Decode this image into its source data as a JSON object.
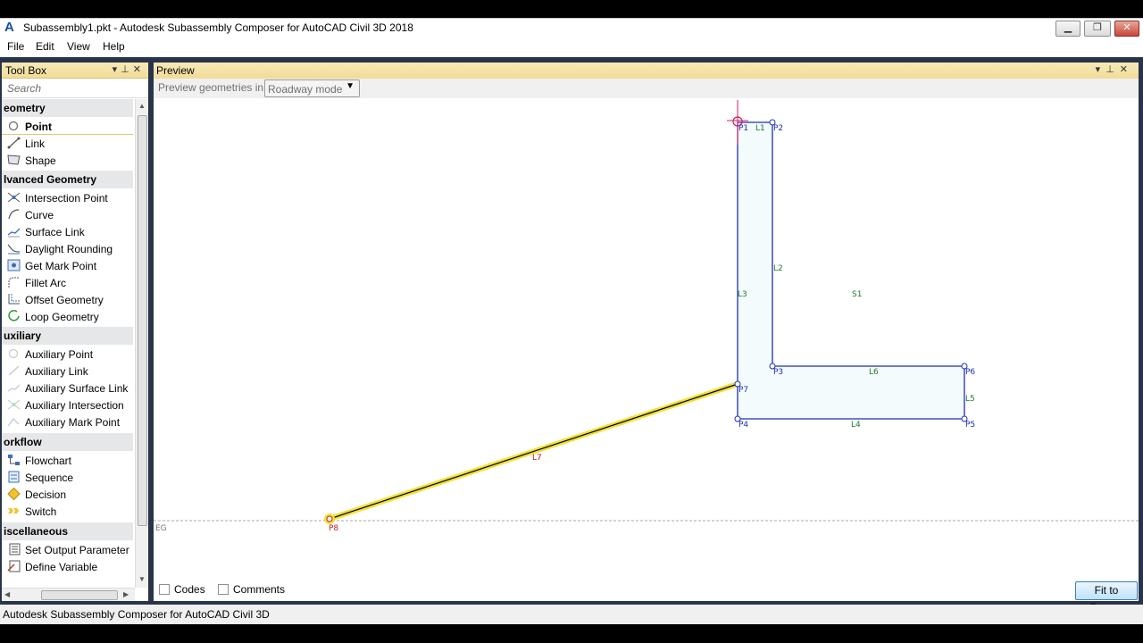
{
  "window": {
    "title": "Subassembly1.pkt - Autodesk Subassembly Composer for AutoCAD Civil 3D 2018",
    "icon": "A",
    "buttons": {
      "minimize": "▁",
      "maximize": "❐",
      "close": "✕"
    }
  },
  "menu": [
    "File",
    "Edit",
    "View",
    "Help"
  ],
  "toolbox": {
    "title": "Tool Box",
    "search_placeholder": "Search",
    "groups": [
      {
        "name": "eometry",
        "items": [
          {
            "label": "Point",
            "icon": "point-icon",
            "selected": true
          },
          {
            "label": "Link",
            "icon": "link-icon"
          },
          {
            "label": "Shape",
            "icon": "shape-icon"
          }
        ]
      },
      {
        "name": "lvanced Geometry",
        "items": [
          {
            "label": "Intersection Point",
            "icon": "intersection-point-icon"
          },
          {
            "label": "Curve",
            "icon": "curve-icon"
          },
          {
            "label": "Surface Link",
            "icon": "surface-link-icon"
          },
          {
            "label": "Daylight Rounding",
            "icon": "daylight-rounding-icon"
          },
          {
            "label": "Get Mark Point",
            "icon": "get-mark-point-icon"
          },
          {
            "label": "Fillet Arc",
            "icon": "fillet-arc-icon"
          },
          {
            "label": "Offset Geometry",
            "icon": "offset-geometry-icon"
          },
          {
            "label": "Loop Geometry",
            "icon": "loop-geometry-icon"
          }
        ]
      },
      {
        "name": "uxiliary",
        "items": [
          {
            "label": "Auxiliary Point",
            "icon": "auxiliary-point-icon"
          },
          {
            "label": "Auxiliary Link",
            "icon": "auxiliary-link-icon"
          },
          {
            "label": "Auxiliary Surface Link",
            "icon": "auxiliary-surface-link-icon"
          },
          {
            "label": "Auxiliary Intersection",
            "icon": "auxiliary-intersection-icon"
          },
          {
            "label": "Auxiliary Mark Point",
            "icon": "auxiliary-mark-point-icon"
          }
        ]
      },
      {
        "name": "orkflow",
        "items": [
          {
            "label": "Flowchart",
            "icon": "flowchart-icon"
          },
          {
            "label": "Sequence",
            "icon": "sequence-icon"
          },
          {
            "label": "Decision",
            "icon": "decision-icon"
          },
          {
            "label": "Switch",
            "icon": "switch-icon"
          }
        ]
      },
      {
        "name": "iscellaneous",
        "items": [
          {
            "label": "Set Output Parameter",
            "icon": "set-output-parameter-icon"
          },
          {
            "label": "Define Variable",
            "icon": "define-variable-icon"
          }
        ]
      }
    ]
  },
  "preview": {
    "title": "Preview",
    "mode_label": "Preview geometries in",
    "mode_value": "Roadway mode",
    "geometry_labels": {
      "points": [
        "P1",
        "P2",
        "P3",
        "P4",
        "P5",
        "P6",
        "P7",
        "P8"
      ],
      "links": [
        "L1",
        "L2",
        "L3",
        "L4",
        "L5",
        "L6",
        "L7"
      ],
      "shapes": [
        "S1"
      ],
      "surface": "EG"
    },
    "codes_label": "Codes",
    "comments_label": "Comments",
    "fit_button": "Fit to Screen"
  },
  "colors": {
    "shape_outline": "#1f2fb4",
    "shape_fill": "#f3fbfd",
    "link_highlight": "#f2e03a",
    "label_green": "#1f7a2a",
    "label_red": "#c01f1f"
  },
  "status": "Autodesk Subassembly Composer for AutoCAD Civil 3D"
}
